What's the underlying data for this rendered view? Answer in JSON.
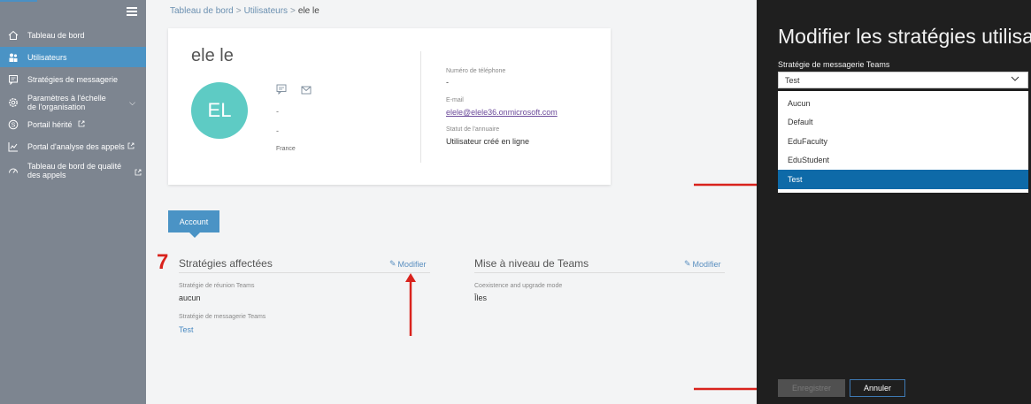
{
  "sidebar": {
    "items": [
      {
        "label": "Tableau de bord",
        "icon": "home-icon"
      },
      {
        "label": "Utilisateurs",
        "icon": "users-icon",
        "active": true
      },
      {
        "label": "Stratégies de messagerie",
        "icon": "messaging-icon"
      },
      {
        "label": "Paramètres à l'échelle de l'organisation",
        "icon": "gear-icon"
      },
      {
        "label": "Portail hérité",
        "icon": "skype-icon"
      },
      {
        "label": "Portal d'analyse des appels",
        "icon": "chart-icon"
      },
      {
        "label": "Tableau de bord de qualité des appels",
        "icon": "gauge-icon"
      }
    ]
  },
  "breadcrumb": {
    "items": [
      "Tableau de bord",
      "Utilisateurs"
    ],
    "current": "ele le"
  },
  "profile": {
    "name": "ele le",
    "initials": "EL",
    "line1": "-",
    "line2": "-",
    "country": "France",
    "phone_label": "Numéro de téléphone",
    "phone_value": "-",
    "email_label": "E-mail",
    "email_value": "elele@elele36.onmicrosoft.com",
    "directory_label": "Statut de l'annuaire",
    "directory_value": "Utilisateur créé en ligne"
  },
  "tabs": {
    "account": "Account"
  },
  "annotation": {
    "step": "7"
  },
  "policies": {
    "title": "Stratégies affectées",
    "edit": "Modifier",
    "meeting_label": "Stratégie de réunion Teams",
    "meeting_value": "aucun",
    "messaging_label": "Stratégie de messagerie Teams",
    "messaging_value": "Test"
  },
  "upgrade": {
    "title": "Mise à niveau de Teams",
    "edit": "Modifier",
    "mode_label": "Coexistence and upgrade mode",
    "mode_value": "Îles"
  },
  "panel": {
    "title": "Modifier les stratégies utilisa",
    "field_label": "Stratégie de messagerie Teams",
    "selected": "Test",
    "options": [
      "Aucun",
      "Default",
      "EduFaculty",
      "EduStudent",
      "Test"
    ],
    "save": "Enregistrer",
    "cancel": "Annuler"
  },
  "colors": {
    "sidebar": "#7d8590",
    "accent": "#4a93c5",
    "selected_option": "#0e6aa8",
    "arrow": "#d9231d",
    "panel": "#1f1f1f"
  }
}
